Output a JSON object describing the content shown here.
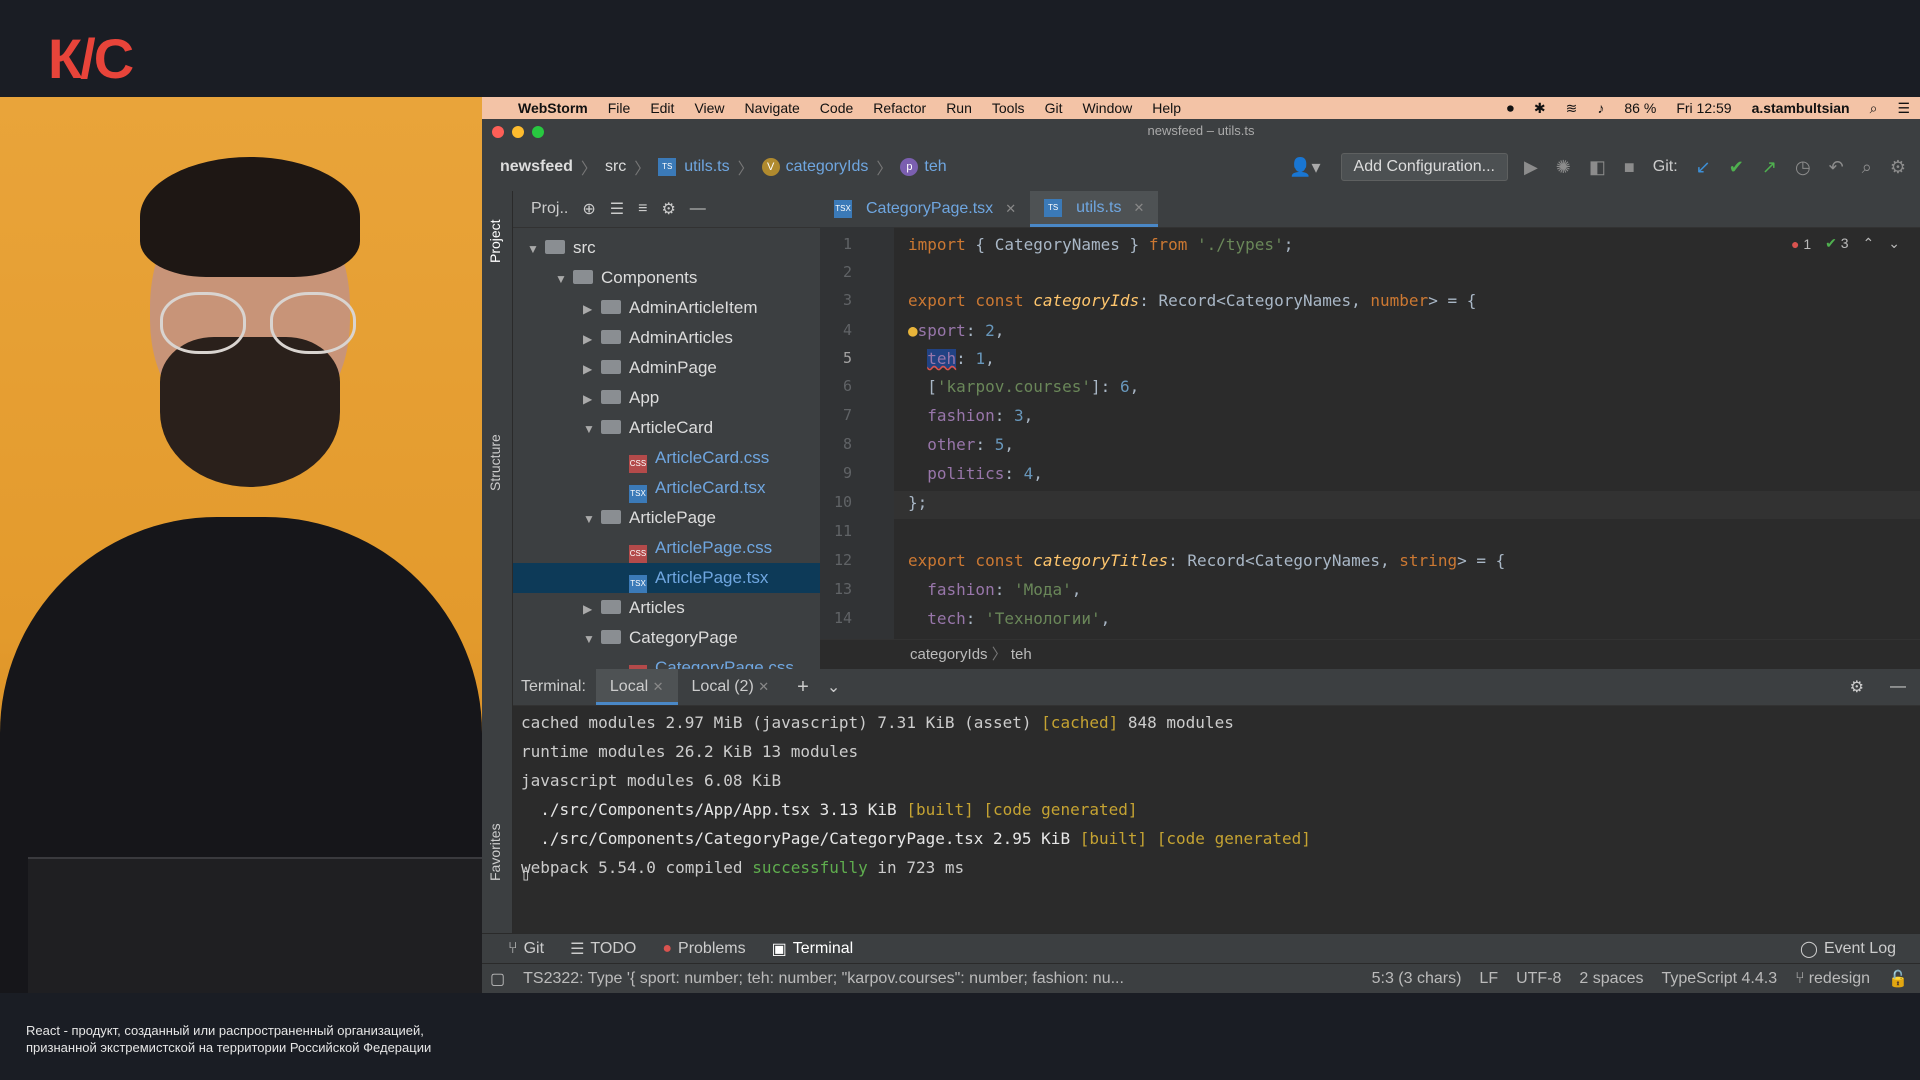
{
  "logo": "К/С",
  "disclaimer": [
    "React - продукт, созданный или распространенный организацией,",
    "признанной экстремистской на территории Российской Федерации"
  ],
  "mac_menu": {
    "app": "WebStorm",
    "items": [
      "File",
      "Edit",
      "View",
      "Navigate",
      "Code",
      "Refactor",
      "Run",
      "Tools",
      "Git",
      "Window",
      "Help"
    ],
    "battery": "86 %",
    "clock": "Fri 12:59",
    "user": "a.stambultsian"
  },
  "window_title": "newsfeed – utils.ts",
  "breadcrumbs": {
    "project": "newsfeed",
    "folder": "src",
    "file": "utils.ts",
    "variable": "categoryIds",
    "property": "teh",
    "variable_badge": "V",
    "property_badge": "p"
  },
  "toolbar": {
    "add_configuration": "Add Configuration...",
    "git_label": "Git:"
  },
  "left_tool_tabs": [
    "Project",
    "Structure",
    "Favorites"
  ],
  "project_panel": {
    "title": "Proj..",
    "tree": [
      {
        "label": "src",
        "type": "folder",
        "expanded": true
      },
      {
        "label": "Components",
        "type": "folder",
        "expanded": true
      },
      {
        "label": "AdminArticleItem",
        "type": "folder",
        "expanded": false
      },
      {
        "label": "AdminArticles",
        "type": "folder",
        "expanded": false
      },
      {
        "label": "AdminPage",
        "type": "folder",
        "expanded": false
      },
      {
        "label": "App",
        "type": "folder",
        "expanded": false
      },
      {
        "label": "ArticleCard",
        "type": "folder",
        "expanded": true
      },
      {
        "label": "ArticleCard.css",
        "type": "css"
      },
      {
        "label": "ArticleCard.tsx",
        "type": "tsx"
      },
      {
        "label": "ArticlePage",
        "type": "folder",
        "expanded": true
      },
      {
        "label": "ArticlePage.css",
        "type": "css"
      },
      {
        "label": "ArticlePage.tsx",
        "type": "tsx",
        "selected": true
      },
      {
        "label": "Articles",
        "type": "folder",
        "expanded": false
      },
      {
        "label": "CategoryPage",
        "type": "folder",
        "expanded": true
      },
      {
        "label": "CategoryPage.css",
        "type": "css"
      }
    ]
  },
  "editor": {
    "tabs": [
      {
        "label": "CategoryPage.tsx",
        "active": false
      },
      {
        "label": "utils.ts",
        "active": true
      }
    ],
    "file_badges": {
      "tsx": "TSX",
      "ts": "TS",
      "css": "CSS"
    },
    "inspections": {
      "errors": "1",
      "warnings": "3"
    },
    "line_numbers": [
      "1",
      "2",
      "3",
      "4",
      "5",
      "6",
      "7",
      "8",
      "9",
      "10",
      "11",
      "12",
      "13",
      "14"
    ],
    "current_line": 5,
    "code_crumbs": [
      "categoryIds",
      "teh"
    ]
  },
  "terminal": {
    "label": "Terminal:",
    "tabs": [
      "Local",
      "Local (2)"
    ],
    "lines": [
      [
        "cached modules 2.97 MiB (javascript) 7.31 KiB (asset) ",
        "[cached]",
        " 848 modules"
      ],
      [
        "runtime modules 26.2 KiB 13 modules"
      ],
      [
        "javascript modules 6.08 KiB"
      ],
      [
        "  ./src/Components/App/App.tsx 3.13 KiB ",
        "[built] [code generated]"
      ],
      [
        "  ./src/Components/CategoryPage/CategoryPage.tsx 2.95 KiB ",
        "[built] [code generated]"
      ],
      [
        "webpack 5.54.0 compiled ",
        "successfully",
        " in 723 ms"
      ]
    ]
  },
  "bottom_tools": [
    "Git",
    "TODO",
    "Problems",
    "Terminal"
  ],
  "event_log": "Event Log",
  "status": {
    "message": "TS2322: Type '{ sport: number; teh: number; \"karpov.courses\": number; fashion: nu...",
    "position": "5:3 (3 chars)",
    "line_sep": "LF",
    "encoding": "UTF-8",
    "indent": "2 spaces",
    "language": "TypeScript 4.4.3",
    "branch": "redesign"
  }
}
